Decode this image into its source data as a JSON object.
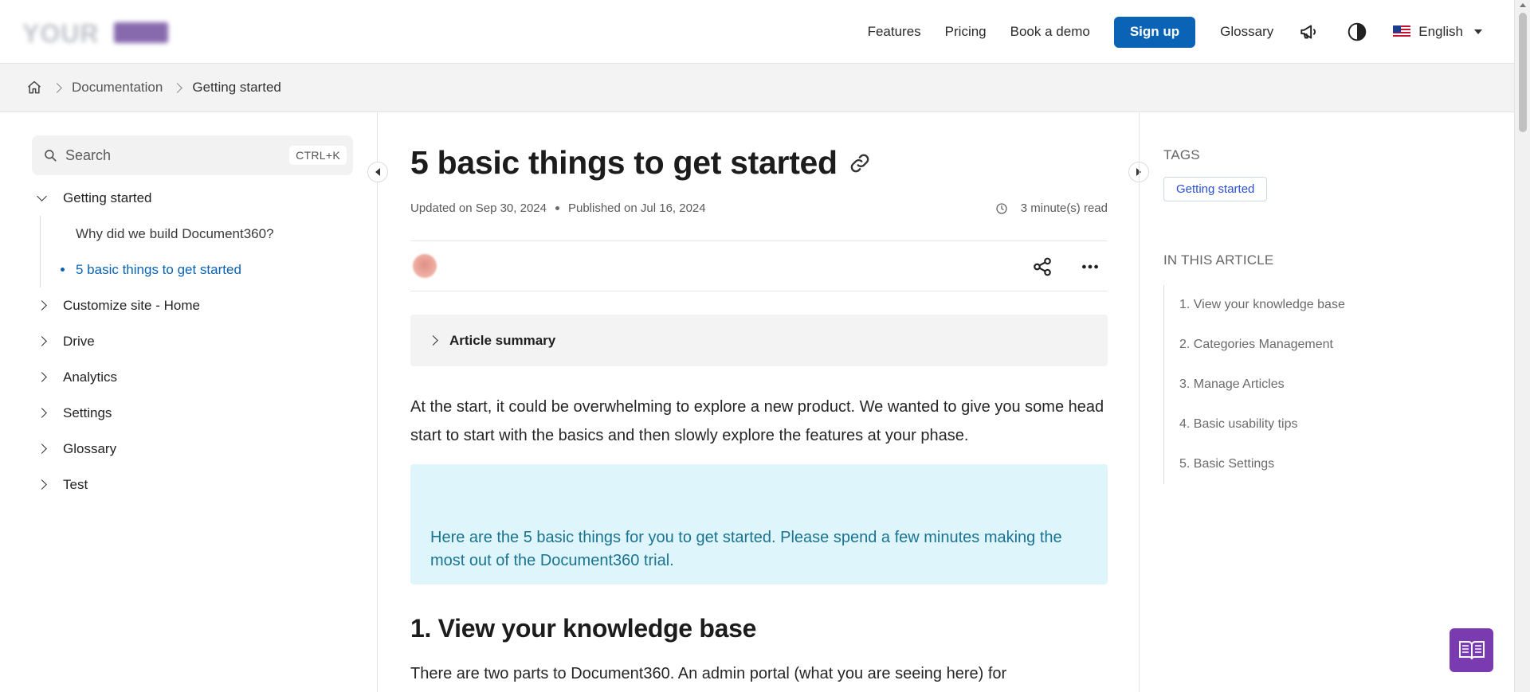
{
  "header": {
    "logo_text": "YOUR",
    "nav_links": [
      "Features",
      "Pricing",
      "Book a demo"
    ],
    "signup_label": "Sign up",
    "glossary_label": "Glossary",
    "language": "English"
  },
  "breadcrumb": {
    "items": [
      "Documentation"
    ],
    "current": "Getting started"
  },
  "sidebar": {
    "search_placeholder": "Search",
    "search_shortcut": "CTRL+K",
    "expanded_item": "Getting started",
    "sub_items": [
      "Why did we build Document360?",
      "5 basic things to get started"
    ],
    "items": [
      "Customize site - Home",
      "Drive",
      "Analytics",
      "Settings",
      "Glossary",
      "Test"
    ]
  },
  "article": {
    "title": "5 basic things to get started",
    "updated": "Updated on Sep 30, 2024",
    "published": "Published on Jul 16, 2024",
    "read_time": "3 minute(s) read",
    "summary_label": "Article summary",
    "intro": "At the start, it could be overwhelming to explore a new product. We wanted to give you some head start to start with the basics and then slowly explore the features at your phase.",
    "callout": "Here are the 5 basic things for you to get started. Please spend a few minutes making the most out of the Document360 trial.",
    "section_heading": "1. View your knowledge base",
    "section_text": "There are two parts to Document360. An admin portal (what you are seeing here) for"
  },
  "rail": {
    "tags_heading": "TAGS",
    "tags": [
      "Getting started"
    ],
    "toc_heading": "IN THIS ARTICLE",
    "toc": [
      "1. View your knowledge base",
      "2. Categories Management",
      "3. Manage Articles",
      "4. Basic usability tips",
      "5. Basic Settings"
    ]
  },
  "colors": {
    "primary": "#0a63b5",
    "callout_bg": "#ddf5fb",
    "callout_text": "#1b7390",
    "fab": "#7b3bb0"
  },
  "icons": [
    "home-icon",
    "search-icon",
    "link-icon",
    "clock-icon",
    "share-icon",
    "more-icon",
    "megaphone-icon",
    "contrast-icon",
    "flag-icon",
    "book-icon"
  ]
}
